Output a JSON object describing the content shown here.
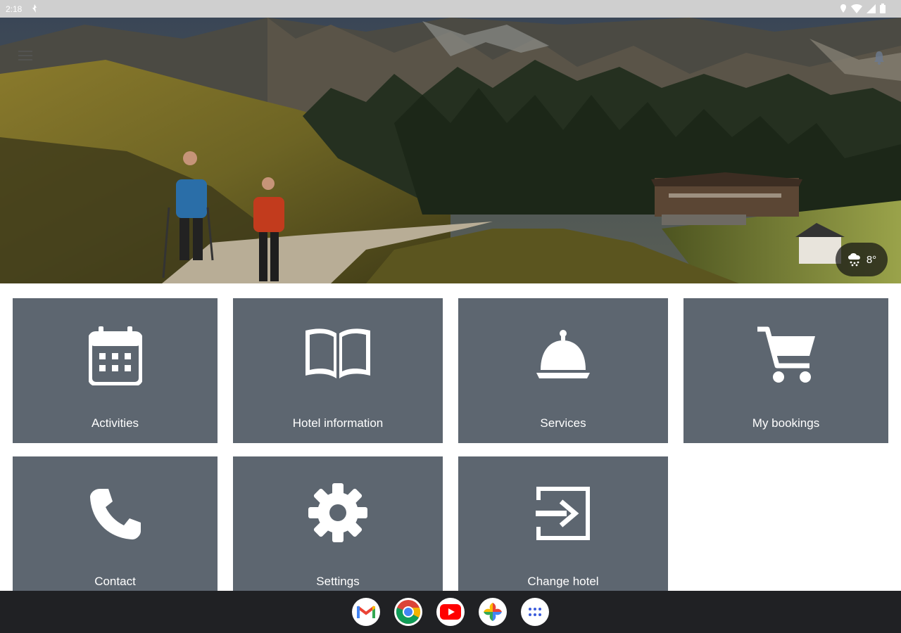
{
  "status_bar": {
    "time": "2:18"
  },
  "weather": {
    "temperature": "8°",
    "icon": "snow-cloud-icon"
  },
  "tiles": [
    {
      "label": "Activities",
      "icon": "calendar-icon"
    },
    {
      "label": "Hotel information",
      "icon": "book-icon"
    },
    {
      "label": "Services",
      "icon": "service-bell-icon"
    },
    {
      "label": "My bookings",
      "icon": "cart-icon"
    },
    {
      "label": "Contact",
      "icon": "phone-icon"
    },
    {
      "label": "Settings",
      "icon": "gear-icon"
    },
    {
      "label": "Change hotel",
      "icon": "login-icon"
    }
  ],
  "taskbar": {
    "apps": [
      "gmail-icon",
      "chrome-icon",
      "youtube-icon",
      "photos-icon",
      "app-launcher-icon"
    ]
  },
  "colors": {
    "tile": "#5d6670",
    "taskbar": "#202124",
    "status_bar": "#cfcfcf"
  }
}
